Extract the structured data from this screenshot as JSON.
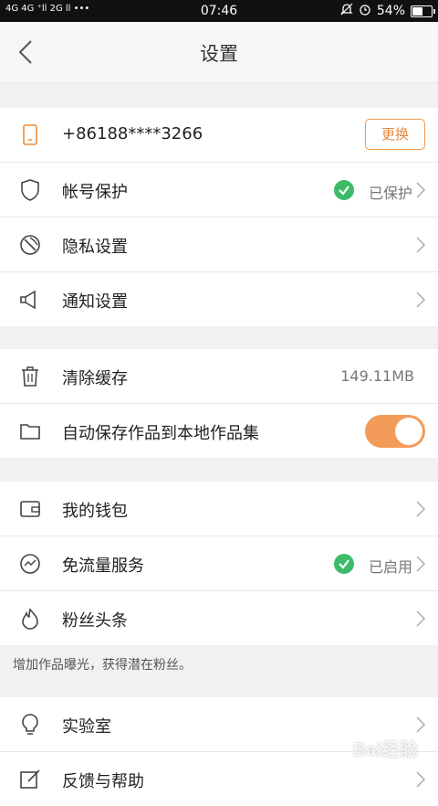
{
  "status_bar": {
    "signal_text": "4G 4G ⁺ll  2G ll  •••",
    "time": "07:46",
    "battery": "54%",
    "battery_level": 0.54
  },
  "header": {
    "title": "设置"
  },
  "groups": [
    {
      "rows": [
        {
          "icon": "phone-icon",
          "label": "+86188****3266",
          "button": "更换"
        },
        {
          "icon": "shield-icon",
          "label": "帐号保护",
          "value": "已保护",
          "checked": true
        },
        {
          "icon": "privacy-icon",
          "label": "隐私设置"
        },
        {
          "icon": "megaphone-icon",
          "label": "通知设置"
        }
      ]
    },
    {
      "rows": [
        {
          "icon": "trash-icon",
          "label": "清除缓存",
          "value": "149.11MB"
        },
        {
          "icon": "folder-icon",
          "label": "自动保存作品到本地作品集",
          "toggle": true
        }
      ]
    },
    {
      "rows": [
        {
          "icon": "wallet-icon",
          "label": "我的钱包"
        },
        {
          "icon": "traffic-icon",
          "label": "免流量服务",
          "value": "已启用",
          "checked": true
        },
        {
          "icon": "flame-icon",
          "label": "粉丝头条"
        }
      ]
    },
    {
      "rows": [
        {
          "icon": "bulb-icon",
          "label": "实验室"
        },
        {
          "icon": "edit-icon",
          "label": "反馈与帮助"
        }
      ]
    }
  ],
  "hint": "增加作品曝光，获得潜在粉丝。",
  "watermark": "Bai经验",
  "colors": {
    "accent": "#f39c5a",
    "check": "#3dbb6a"
  }
}
